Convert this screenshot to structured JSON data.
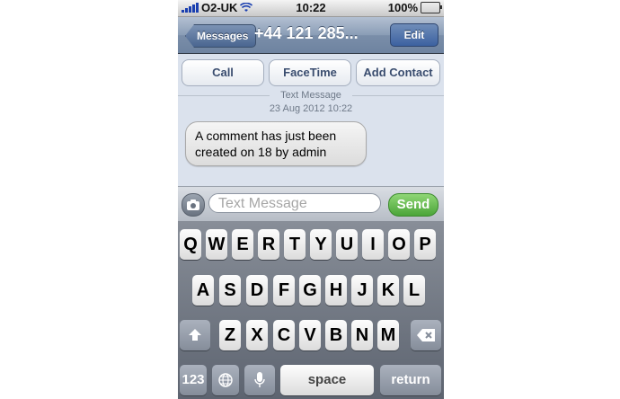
{
  "status": {
    "carrier": "O2-UK",
    "time": "10:22",
    "battery": "100%"
  },
  "nav": {
    "back_label": "Messages",
    "title": "+44 121 285...",
    "edit_label": "Edit"
  },
  "actions": {
    "call": "Call",
    "facetime": "FaceTime",
    "add_contact": "Add Contact"
  },
  "thread": {
    "label": "Text Message",
    "timestamp": "23 Aug 2012 10:22",
    "message": "A comment has just been created on 18 by admin"
  },
  "compose": {
    "placeholder": "Text Message",
    "send_label": "Send"
  },
  "keyboard": {
    "row1": [
      "Q",
      "W",
      "E",
      "R",
      "T",
      "Y",
      "U",
      "I",
      "O",
      "P"
    ],
    "row2": [
      "A",
      "S",
      "D",
      "F",
      "G",
      "H",
      "J",
      "K",
      "L"
    ],
    "row3": [
      "Z",
      "X",
      "C",
      "V",
      "B",
      "N",
      "M"
    ],
    "numbers_label": "123",
    "space_label": "space",
    "return_label": "return"
  },
  "colors": {
    "nav_blue": "#6e83a0",
    "send_green": "#4ba539",
    "bubble_gray": "#e6e6e6"
  }
}
